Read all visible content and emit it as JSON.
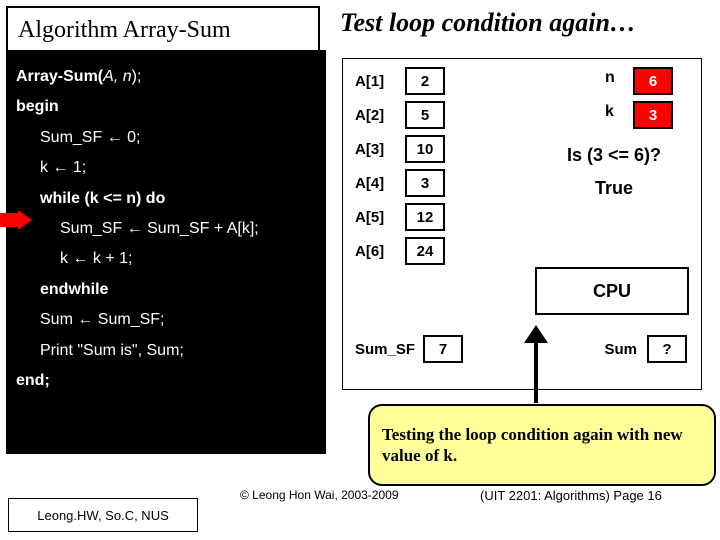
{
  "header": {
    "algo_title": "Algorithm Array-Sum",
    "headline": "Test loop condition again…"
  },
  "code": {
    "l1a": "Array-Sum(",
    "l1b": "A, n",
    "l1c": ");",
    "l2": "begin",
    "l3": "Sum_SF ← 0;",
    "l4": "k ← 1;",
    "l5": "while (k <= n) do",
    "l6": "Sum_SF ← Sum_SF + A[k];",
    "l7": "k ← k + 1;",
    "l8": "endwhile",
    "l9": "Sum ← Sum_SF;",
    "l10": "Print \"Sum is\", Sum;",
    "l11": "end;"
  },
  "array": [
    {
      "label": "A[1]",
      "value": "2"
    },
    {
      "label": "A[2]",
      "value": "5"
    },
    {
      "label": "A[3]",
      "value": "10"
    },
    {
      "label": "A[4]",
      "value": "3"
    },
    {
      "label": "A[5]",
      "value": "12"
    },
    {
      "label": "A[6]",
      "value": "24"
    }
  ],
  "vars": {
    "n_label": "n",
    "n_value": "6",
    "k_label": "k",
    "k_value": "3"
  },
  "cond": {
    "question": "Is (3 <= 6)?",
    "answer": "True"
  },
  "cpu": "CPU",
  "sum_sf": {
    "label": "Sum_SF",
    "value": "7"
  },
  "sum": {
    "label": "Sum",
    "value": "?"
  },
  "note": "Testing the loop condition again with new value of k.",
  "footer": {
    "copyright": "© Leong Hon Wai, 2003-2009",
    "pageref": "(UIT 2201: Algorithms) Page 16",
    "author": "Leong.HW, So.C, NUS"
  }
}
